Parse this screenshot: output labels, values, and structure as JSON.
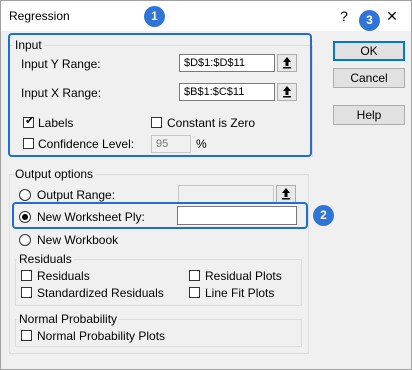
{
  "window": {
    "title": "Regression",
    "help_glyph": "?",
    "close_glyph": "✕"
  },
  "input": {
    "group_label": "Input",
    "y_range_label": "Input Y Range:",
    "y_range_value": "$D$1:$D$11",
    "x_range_label": "Input X Range:",
    "x_range_value": "$B$1:$C$11",
    "labels_label": "Labels",
    "labels_checked": true,
    "constant_zero_label": "Constant is Zero",
    "confidence_label": "Confidence Level:",
    "confidence_value": "95",
    "percent_sign": "%"
  },
  "output": {
    "group_label": "Output options",
    "output_range_label": "Output Range:",
    "new_worksheet_label": "New Worksheet Ply:",
    "new_worksheet_value": "",
    "new_workbook_label": "New Workbook",
    "selected_option": "New Worksheet Ply"
  },
  "residuals": {
    "group_label": "Residuals",
    "residuals_label": "Residuals",
    "standardized_label": "Standardized Residuals",
    "residual_plots_label": "Residual Plots",
    "line_fit_label": "Line Fit Plots"
  },
  "normal_probability": {
    "group_label": "Normal Probability",
    "plots_label": "Normal Probability Plots"
  },
  "buttons": {
    "ok": "OK",
    "cancel": "Cancel",
    "help": "Help"
  },
  "ref_button_icon": "collapse-dialog-icon",
  "badges": {
    "one": "1",
    "two": "2",
    "three": "3"
  },
  "colors": {
    "highlight": "#1f6fd2",
    "badge": "#2f74d6",
    "default_button_border": "#0078d7"
  }
}
